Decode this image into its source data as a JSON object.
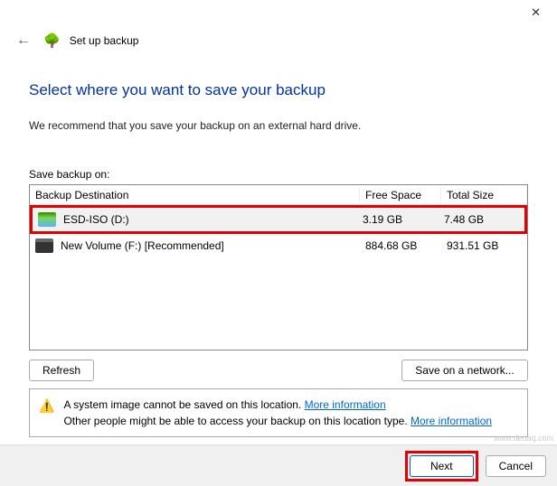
{
  "titlebar": {
    "close": "✕"
  },
  "header": {
    "back": "←",
    "icon": "🌳",
    "title": "Set up backup"
  },
  "heading": "Select where you want to save your backup",
  "subtext": "We recommend that you save your backup on an external hard drive.",
  "list_label": "Save backup on:",
  "columns": {
    "dest": "Backup Destination",
    "free": "Free Space",
    "total": "Total Size"
  },
  "drives": [
    {
      "name": "ESD-ISO (D:)",
      "free": "3.19 GB",
      "total": "7.48 GB",
      "icon": "esd",
      "selected": true
    },
    {
      "name": "New Volume (F:) [Recommended]",
      "free": "884.68 GB",
      "total": "931.51 GB",
      "icon": "hdd",
      "selected": false
    }
  ],
  "refresh": "Refresh",
  "save_network": "Save on a network...",
  "warning": {
    "icon": "⚠️",
    "line1a": "A system image cannot be saved on this location. ",
    "link1": "More information",
    "line2a": "Other people might be able to access your backup on this location type. ",
    "link2": "More information"
  },
  "footer": {
    "next": "Next",
    "cancel": "Cancel"
  },
  "watermark": "www.deuaq.com"
}
